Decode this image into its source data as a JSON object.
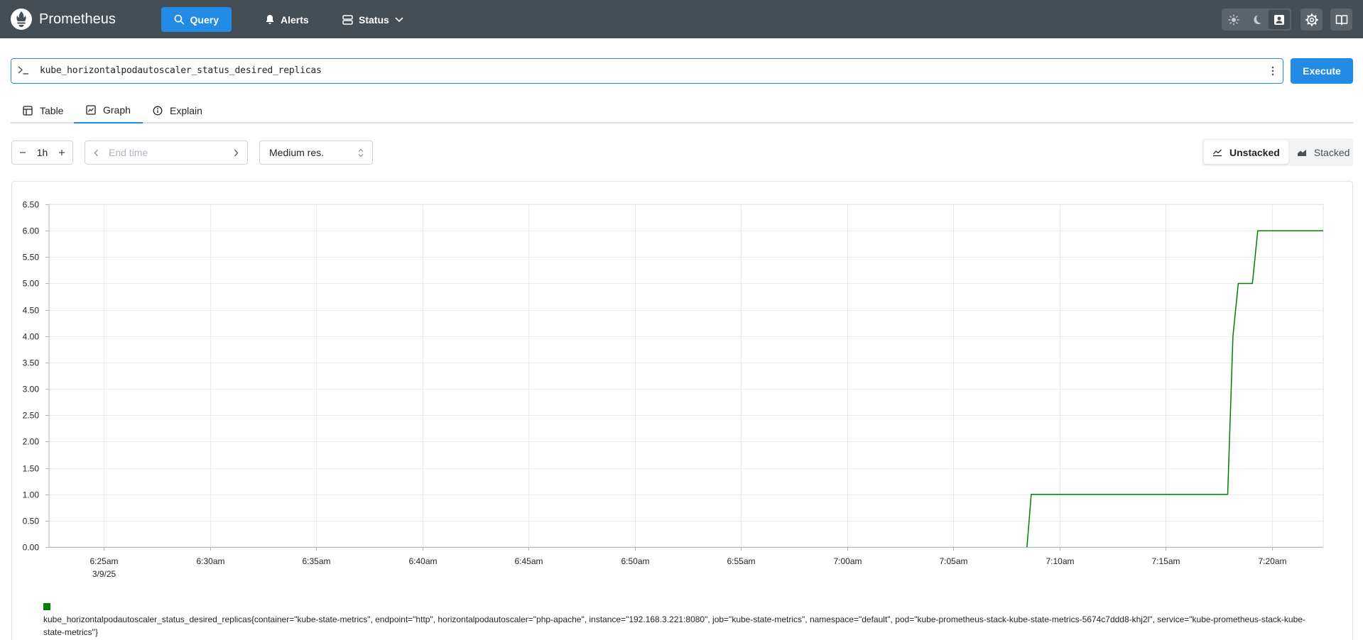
{
  "navbar": {
    "brand": "Prometheus",
    "query_label": "Query",
    "alerts_label": "Alerts",
    "status_label": "Status",
    "accent_color": "#228be6",
    "background_color": "#454d55"
  },
  "query": {
    "expression": "kube_horizontalpodautoscaler_status_desired_replicas",
    "execute_label": "Execute"
  },
  "tabs": {
    "table_label": "Table",
    "graph_label": "Graph",
    "explain_label": "Explain",
    "active": "Graph"
  },
  "controls": {
    "range_value": "1h",
    "end_time_placeholder": "End time",
    "resolution_value": "Medium res.",
    "unstacked_label": "Unstacked",
    "stacked_label": "Stacked",
    "stack_mode": "Unstacked"
  },
  "legend": {
    "series_label": "kube_horizontalpodautoscaler_status_desired_replicas{container=\"kube-state-metrics\", endpoint=\"http\", horizontalpodautoscaler=\"php-apache\", instance=\"192.168.3.221:8080\", job=\"kube-state-metrics\", namespace=\"default\", pod=\"kube-prometheus-stack-kube-state-metrics-5674c7ddd8-khj2l\", service=\"kube-prometheus-stack-kube-state-metrics\"}",
    "swatch_color": "#008000"
  },
  "chart_data": {
    "type": "line",
    "title": "",
    "xlabel": "",
    "ylabel": "",
    "ylim": [
      0,
      6.5
    ],
    "yticks": [
      "0.00",
      "0.50",
      "1.00",
      "1.50",
      "2.00",
      "2.50",
      "3.00",
      "3.50",
      "4.00",
      "4.50",
      "5.00",
      "5.50",
      "6.00",
      "6.50"
    ],
    "xticks": [
      {
        "t": "6:25",
        "label": "6:25am",
        "sublabel": "3/9/25"
      },
      {
        "t": "6:30",
        "label": "6:30am"
      },
      {
        "t": "6:35",
        "label": "6:35am"
      },
      {
        "t": "6:40",
        "label": "6:40am"
      },
      {
        "t": "6:45",
        "label": "6:45am"
      },
      {
        "t": "6:50",
        "label": "6:50am"
      },
      {
        "t": "6:55",
        "label": "6:55am"
      },
      {
        "t": "7:00",
        "label": "7:00am"
      },
      {
        "t": "7:05",
        "label": "7:05am"
      },
      {
        "t": "7:10",
        "label": "7:10am"
      },
      {
        "t": "7:15",
        "label": "7:15am"
      },
      {
        "t": "7:20",
        "label": "7:20am"
      }
    ],
    "xrange": [
      "6:22:25",
      "7:22:25"
    ],
    "grid": true,
    "series": [
      {
        "color": "#008000",
        "points": [
          {
            "x": "7:08:28",
            "y": 0
          },
          {
            "x": "7:08:40",
            "y": 1
          },
          {
            "x": "7:17:55",
            "y": 1
          },
          {
            "x": "7:18:10",
            "y": 4
          },
          {
            "x": "7:18:25",
            "y": 5
          },
          {
            "x": "7:19:05",
            "y": 5
          },
          {
            "x": "7:19:20",
            "y": 6
          },
          {
            "x": "7:22:25",
            "y": 6
          }
        ]
      }
    ]
  }
}
